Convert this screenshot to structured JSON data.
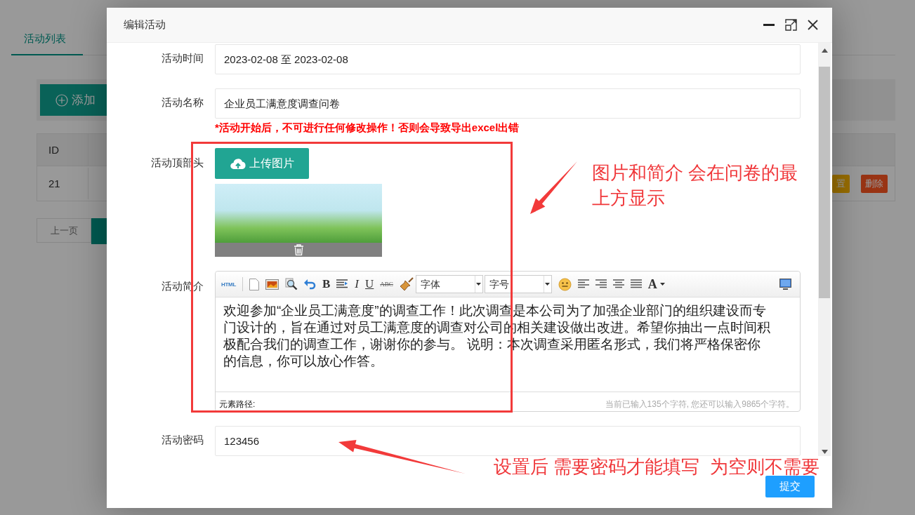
{
  "background_page": {
    "tab": "活动列表",
    "add_button": "添加",
    "table": {
      "columns": [
        "ID"
      ],
      "rows": [
        [
          "21"
        ]
      ]
    },
    "row_actions": [
      "置",
      "删除"
    ],
    "pagination": {
      "prev": "上一页"
    }
  },
  "dialog": {
    "title": "编辑活动",
    "time": {
      "label": "活动时间",
      "value": "2023-02-08 至 2023-02-08"
    },
    "name": {
      "label": "活动名称",
      "value": "企业员工满意度调查问卷"
    },
    "warning": "*活动开始后，不可进行任何修改操作！否则会导致导出excel出错",
    "header_image": {
      "label": "活动顶部头",
      "upload_button": "上传图片"
    },
    "intro": {
      "label": "活动简介",
      "toolbar": {
        "html": "HTML",
        "bold": "B",
        "italic": "I",
        "underline": "U",
        "strike": "ABC",
        "font": "字体",
        "size": "字号",
        "font_color": "A"
      },
      "text": "欢迎参加“企业员工满意度”的调查工作！此次调查是本公司为了加强企业部门的组织建设而专门设计的，旨在通过对员工满意度的调查对公司的相关建设做出改进。希望你抽出一点时间积极配合我们的调查工作，谢谢你的参与。 说明：本次调查采用匿名形式，我们将严格保密你的信息，你可以放心作答。",
      "path_label": "元素路径:",
      "char_count": "当前已输入135个字符, 您还可以输入9865个字符。"
    },
    "password": {
      "label": "活动密码",
      "value": "123456"
    },
    "submit": "提交"
  },
  "annotations": {
    "notes": [
      "图片和简介 会在问卷的最上方显示",
      "设置后 需要密码才能填写  为空则不需要"
    ]
  }
}
